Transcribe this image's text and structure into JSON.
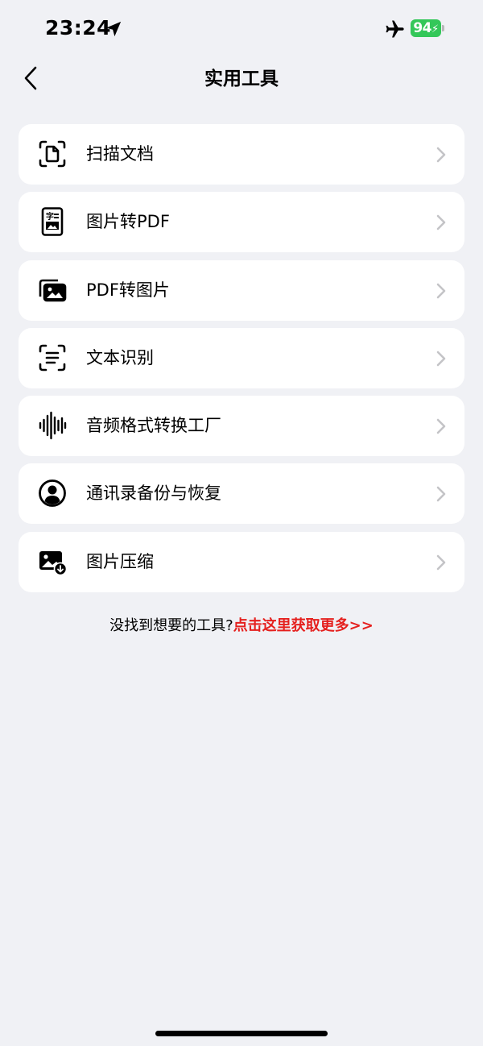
{
  "status_bar": {
    "time": "23:24",
    "battery": "94",
    "icons": [
      "location-arrow-icon",
      "airplane-icon",
      "battery-charging-icon"
    ]
  },
  "header": {
    "title": "实用工具",
    "back_icon": "chevron-left-icon"
  },
  "tools": [
    {
      "label": "扫描文档",
      "icon": "scan-document-icon"
    },
    {
      "label": "图片转PDF",
      "icon": "image-to-pdf-icon"
    },
    {
      "label": "PDF转图片",
      "icon": "pdf-to-image-icon"
    },
    {
      "label": "文本识别",
      "icon": "text-recognition-icon"
    },
    {
      "label": "音频格式转换工厂",
      "icon": "audio-waveform-icon"
    },
    {
      "label": "通讯录备份与恢复",
      "icon": "contact-backup-icon"
    },
    {
      "label": "图片压缩",
      "icon": "image-compress-icon"
    }
  ],
  "footer": {
    "question": "没找到想要的工具?",
    "link": "点击这里获取更多>>"
  },
  "colors": {
    "background": "#f0f1f5",
    "card": "#ffffff",
    "accent_link": "#e5201e",
    "battery": "#34c759"
  }
}
